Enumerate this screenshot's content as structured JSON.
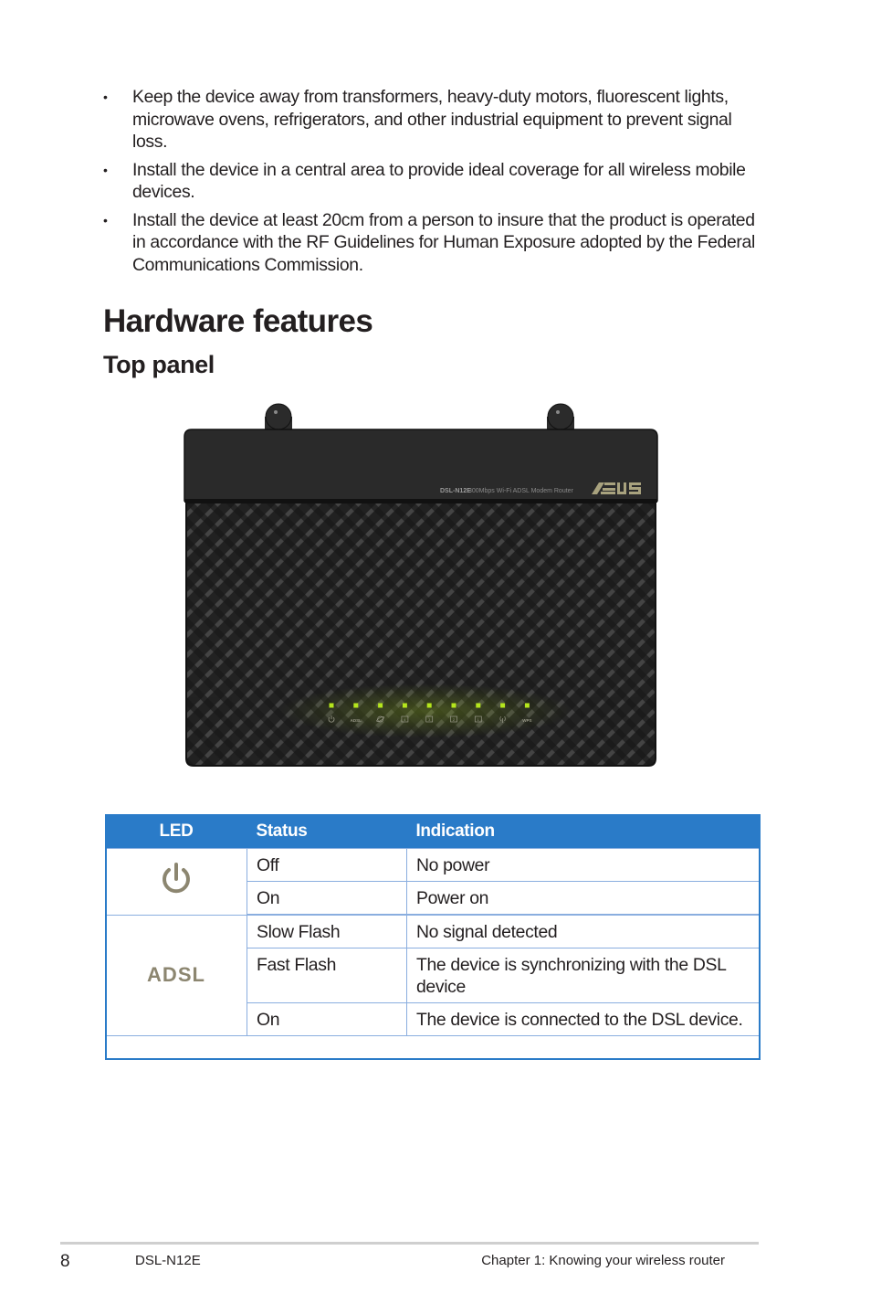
{
  "bullets": [
    "Keep the device away from transformers, heavy-duty motors, fluorescent lights, microwave ovens, refrigerators, and other industrial equipment to prevent signal loss.",
    "Install the device in a central area to provide ideal coverage for all wireless mobile devices.",
    "Install the device at least 20cm from a person to insure that the product is operated in accordance with the RF Guidelines for Human Exposure adopted by the Federal Communications Commission."
  ],
  "bullet_glyph": "•",
  "heading": "Hardware features",
  "subheading": "Top panel",
  "router": {
    "model_label": "DSL-N12E",
    "tagline": "300Mbps Wi-Fi ADSL Modem Router",
    "brand": "/ISUS",
    "led_color": "#b5e61d",
    "leds": [
      {
        "name": "power",
        "icon": "power-icon",
        "label": ""
      },
      {
        "name": "adsl",
        "icon": "text",
        "label": "ADSL"
      },
      {
        "name": "internet",
        "icon": "globe-icon",
        "label": ""
      },
      {
        "name": "lan4",
        "icon": "lan-port-icon",
        "label": "4"
      },
      {
        "name": "lan3",
        "icon": "lan-port-icon",
        "label": "3"
      },
      {
        "name": "lan2",
        "icon": "lan-port-icon",
        "label": "2"
      },
      {
        "name": "lan1",
        "icon": "lan-port-icon",
        "label": "1"
      },
      {
        "name": "wifi",
        "icon": "wireless-icon",
        "label": ""
      },
      {
        "name": "wps",
        "icon": "text",
        "label": "WPS"
      }
    ]
  },
  "table": {
    "headers": {
      "led": "LED",
      "status": "Status",
      "indication": "Indication"
    },
    "header_color": "#2a7bc8",
    "groups": [
      {
        "led_icon": "power-icon",
        "led_label": "",
        "rows": [
          {
            "status": "Off",
            "indication": "No power"
          },
          {
            "status": "On",
            "indication": "Power on"
          }
        ]
      },
      {
        "led_icon": "adsl-text-icon",
        "led_label": "ADSL",
        "rows": [
          {
            "status": "Slow Flash",
            "indication": "No signal detected"
          },
          {
            "status": "Fast Flash",
            "indication": "The device is synchronizing with the DSL device"
          },
          {
            "status": "On",
            "indication": "The device is connected to the DSL device."
          }
        ]
      }
    ]
  },
  "footer": {
    "page_number": "8",
    "model": "DSL-N12E",
    "chapter": "Chapter 1: Knowing your wireless router"
  }
}
